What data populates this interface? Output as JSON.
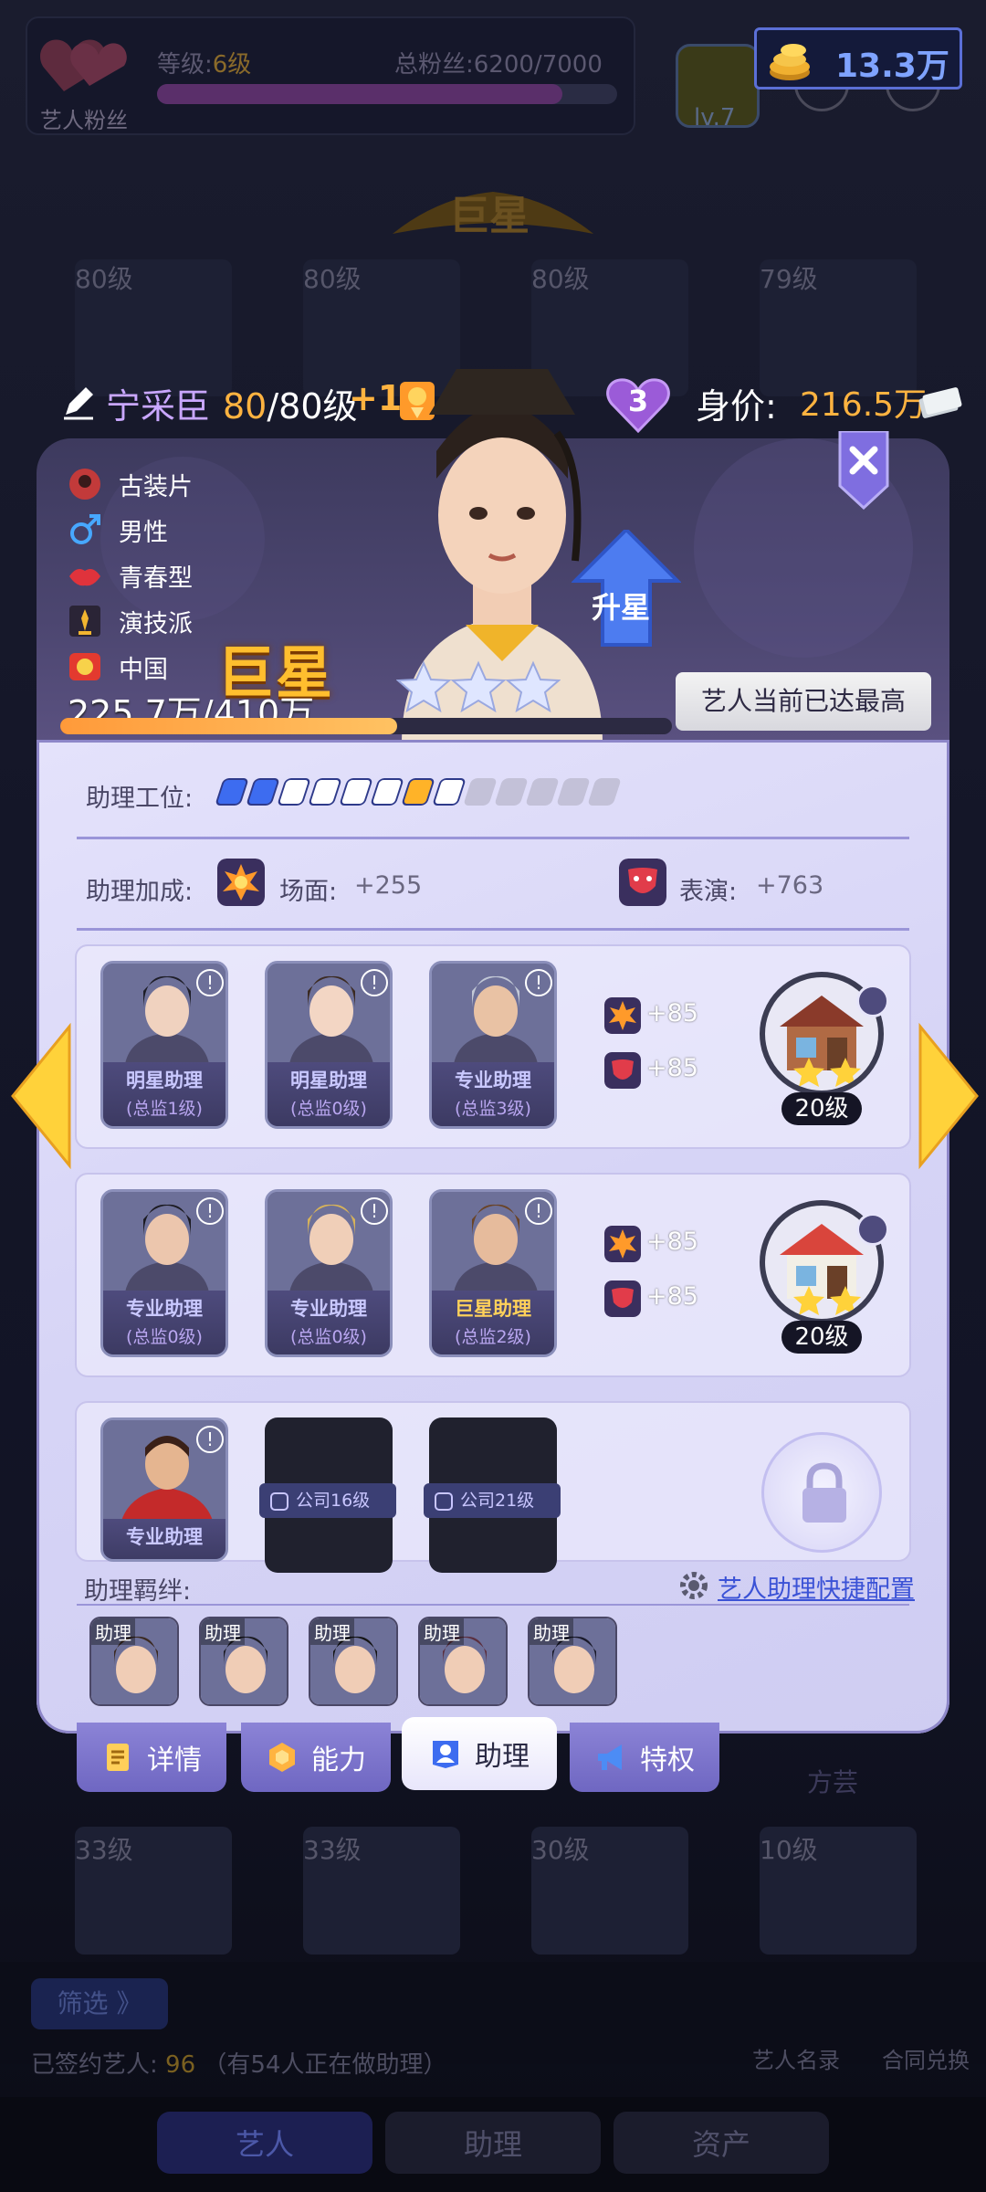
{
  "top_bar": {
    "fan_label": "艺人粉丝",
    "level_prefix": "等级:",
    "level_value": "6级",
    "total_fans_prefix": "总粉丝:",
    "total_fans_value": "6200/7000",
    "fan_progress": 0.88,
    "lv_badge": "lv.7",
    "coins": "13.3万"
  },
  "background": {
    "banner": "巨星",
    "top_cards": [
      "80级",
      "80级",
      "80级",
      "79级"
    ],
    "bottom_cards": [
      "33级",
      "33级",
      "30级",
      "10级"
    ],
    "filter_label": "筛选 》",
    "signed_label": "已签约艺人:",
    "signed_count": "96",
    "signed_note": "（有54人正在做助理）",
    "directory_label": "艺人名录",
    "contract_label": "合同兑换",
    "right_faded_label": "方芸",
    "nav": [
      "艺人",
      "助理",
      "资产"
    ]
  },
  "artist": {
    "name": "宁采臣",
    "level_current": "80",
    "level_max": "/80级",
    "level_bonus": "+1",
    "hearts": "3",
    "value_label": "身价:",
    "value": "216.5万",
    "tags": [
      "古装片",
      "男性",
      "青春型",
      "演技派",
      "中国"
    ],
    "rank": "巨星",
    "stars": 3,
    "exp_text": "225.7万/410万",
    "exp_progress": 0.55,
    "upgrade_label": "升星",
    "max_label": "艺人当前已达最高"
  },
  "assistant": {
    "slots_label": "助理工位:",
    "slots": [
      "blue",
      "blue",
      "white",
      "white",
      "white",
      "white",
      "gold",
      "white",
      "grey",
      "grey",
      "grey",
      "grey",
      "grey"
    ],
    "bonus_label": "助理加成:",
    "bonus": [
      {
        "icon": "scene-icon",
        "name": "场面:",
        "value": "+255"
      },
      {
        "icon": "performance-icon",
        "name": "表演:",
        "value": "+763"
      }
    ],
    "groups": [
      {
        "cards": [
          {
            "name": "明星助理",
            "sub": "(总监1级)",
            "gold": false
          },
          {
            "name": "明星助理",
            "sub": "(总监0级)",
            "gold": false
          },
          {
            "name": "专业助理",
            "sub": "(总监3级)",
            "gold": false
          }
        ],
        "scene": "+85",
        "perf": "+85",
        "building_level": "20级"
      },
      {
        "cards": [
          {
            "name": "专业助理",
            "sub": "(总监0级)",
            "gold": false
          },
          {
            "name": "专业助理",
            "sub": "(总监0级)",
            "gold": false
          },
          {
            "name": "巨星助理",
            "sub": "(总监2级)",
            "gold": true
          }
        ],
        "scene": "+85",
        "perf": "+85",
        "building_level": "20级"
      }
    ],
    "group3": {
      "card_name": "专业助理",
      "locked": [
        "公司16级",
        "公司21级"
      ]
    },
    "bond_label": "助理羁绊:",
    "quick_config": "艺人助理快捷配置",
    "bond_tag": "助理",
    "bond_count": 5
  },
  "tabs": [
    "详情",
    "能力",
    "助理",
    "特权"
  ],
  "colors": {
    "accent_gold": "#ffb340",
    "name_purple": "#c9a7ff",
    "link_blue": "#3b52d6"
  }
}
